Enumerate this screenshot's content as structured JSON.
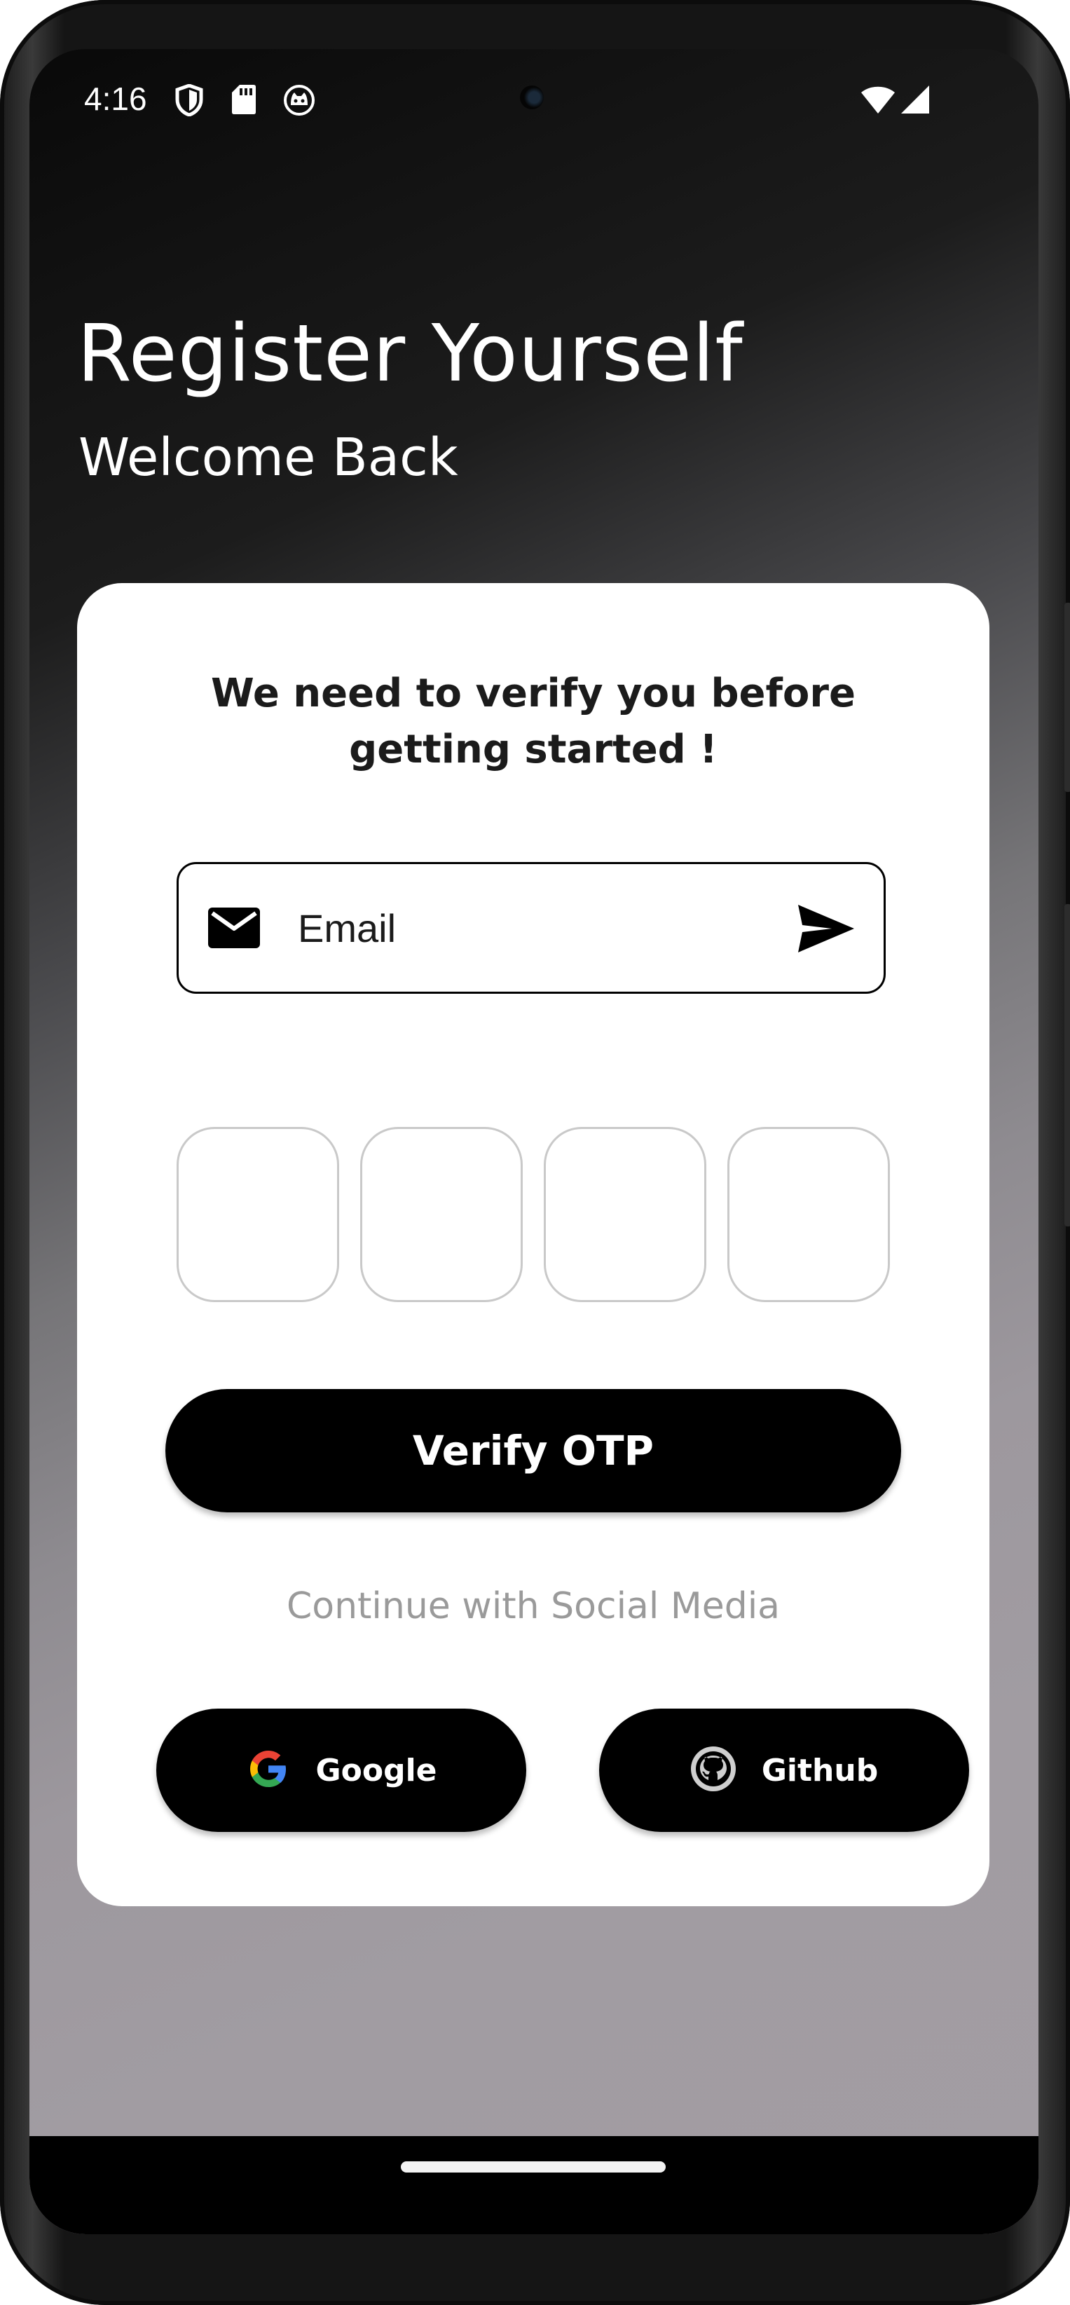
{
  "status_bar": {
    "time": "4:16",
    "left_icons": [
      "shield-icon",
      "sd-card-icon",
      "cat-face-icon"
    ],
    "right_icons": [
      "wifi-icon",
      "cellular-signal-icon"
    ]
  },
  "header": {
    "title": "Register Yourself",
    "subtitle": "Welcome Back"
  },
  "card": {
    "title": "We need to verify you before getting started !",
    "email": {
      "placeholder": "Email",
      "value": "",
      "leading_icon": "mail-icon",
      "action_icon": "send-icon"
    },
    "otp_boxes": [
      "",
      "",
      "",
      ""
    ],
    "verify_label": "Verify OTP",
    "social_text": "Continue with Social Media",
    "social_buttons": [
      {
        "label": "Google",
        "icon": "google-icon"
      },
      {
        "label": "Github",
        "icon": "github-icon"
      }
    ]
  },
  "colors": {
    "primary": "#000000",
    "card": "#ffffff",
    "muted_text": "#9a9a9a",
    "otp_border": "#c9c9c9"
  }
}
